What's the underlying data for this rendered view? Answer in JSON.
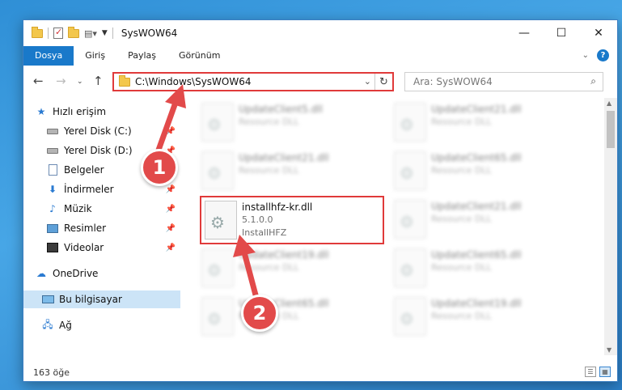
{
  "window": {
    "title": "SysWOW64",
    "minimize": "—",
    "maximize": "☐",
    "close": "✕"
  },
  "ribbon": {
    "tabs": [
      "Dosya",
      "Giriş",
      "Paylaş",
      "Görünüm"
    ],
    "help": "?"
  },
  "address": {
    "path": "C:\\Windows\\SysWOW64",
    "search_placeholder": "Ara: SysWOW64"
  },
  "nav": {
    "items": [
      {
        "label": "Hızlı erişim",
        "icon": "star-icon",
        "pinned": false
      },
      {
        "label": "Yerel Disk (C:)",
        "icon": "drive-icon",
        "pinned": true
      },
      {
        "label": "Yerel Disk (D:)",
        "icon": "drive-icon",
        "pinned": true
      },
      {
        "label": "Belgeler",
        "icon": "document-icon",
        "pinned": true
      },
      {
        "label": "İndirmeler",
        "icon": "download-icon",
        "pinned": true
      },
      {
        "label": "Müzik",
        "icon": "music-icon",
        "pinned": true
      },
      {
        "label": "Resimler",
        "icon": "pictures-icon",
        "pinned": true
      },
      {
        "label": "Videolar",
        "icon": "videos-icon",
        "pinned": true
      },
      {
        "label": "OneDrive",
        "icon": "cloud-icon",
        "pinned": false
      },
      {
        "label": "Bu bilgisayar",
        "icon": "computer-icon",
        "pinned": false,
        "selected": true
      },
      {
        "label": "Ağ",
        "icon": "network-icon",
        "pinned": false
      }
    ]
  },
  "files": [
    {
      "name": "UpdateClient5.dll",
      "sub": "Resource DLL"
    },
    {
      "name": "UpdateClient21.dll",
      "sub": "Resource DLL"
    },
    {
      "name": "UpdateClient21.dll",
      "sub": "Resource DLL"
    },
    {
      "name": "UpdateClient65.dll",
      "sub": "Resource DLL"
    },
    {
      "name": "UpdateClient21.dll",
      "sub": "Resource DLL"
    },
    {
      "name": "UpdateClient19.dll",
      "sub": "Resource DLL"
    },
    {
      "name": "UpdateClient65.dll",
      "sub": "Resource DLL"
    },
    {
      "name": "UpdateClient65.dll",
      "sub": "Resource DLL"
    },
    {
      "name": "UpdateClient19.dll",
      "sub": "Resource DLL"
    }
  ],
  "highlighted_file": {
    "name": "installhfz-kr.dll",
    "version": "5.1.0.0",
    "company": "InstallHFZ"
  },
  "status": {
    "count": "163 öğe"
  },
  "annotations": {
    "badge1": "1",
    "badge2": "2",
    "color": "#e24a4a"
  }
}
